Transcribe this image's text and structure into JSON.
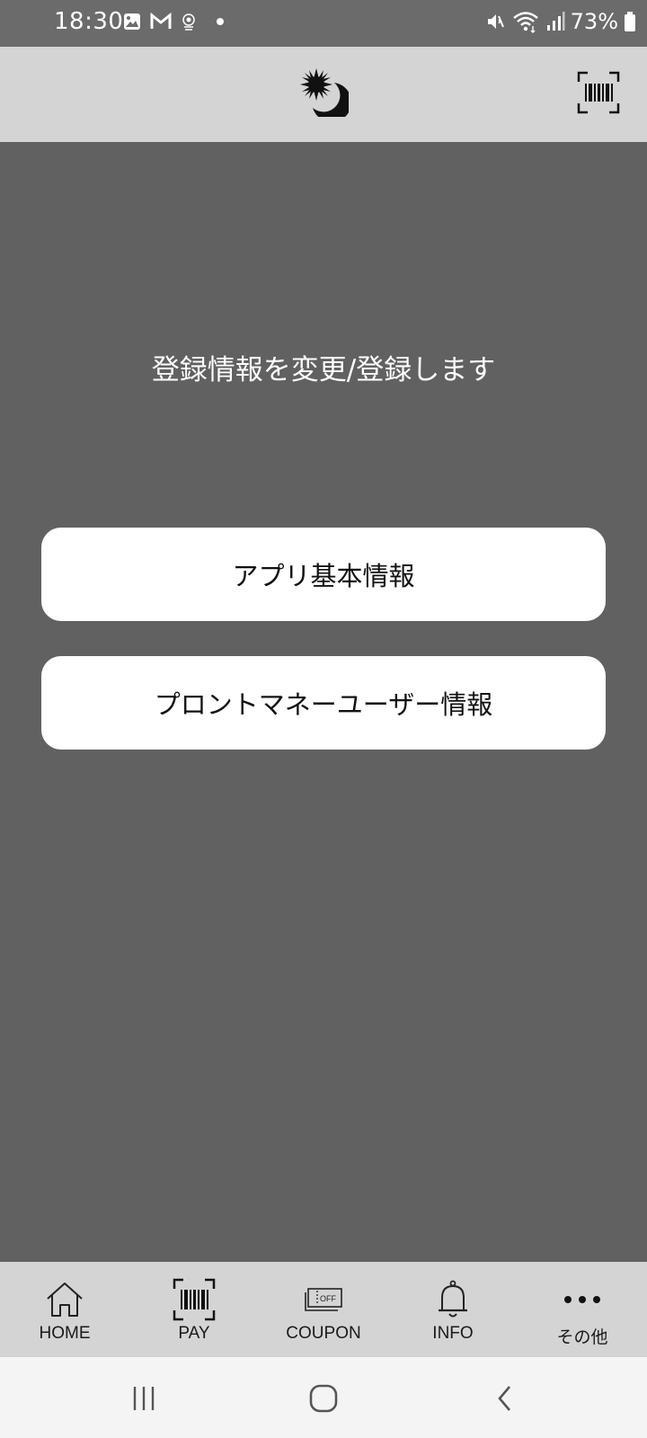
{
  "status_bar": {
    "time": "18:30",
    "battery": "73%",
    "left_icons": [
      "gallery-icon",
      "gmail-icon",
      "app-notification-icon",
      "dot-icon"
    ],
    "right_icons": [
      "mute-icon",
      "wifi-icon",
      "signal-icon",
      "battery-icon"
    ]
  },
  "header": {
    "logo": "sun-moon-logo",
    "barcode_button": "barcode-scan-icon"
  },
  "main": {
    "heading": "登録情報を変更/登録します",
    "buttons": [
      {
        "label": "アプリ基本情報"
      },
      {
        "label": "プロントマネーユーザー情報"
      }
    ]
  },
  "tabbar": {
    "tabs": [
      {
        "label": "HOME",
        "icon": "home-icon"
      },
      {
        "label": "PAY",
        "icon": "barcode-icon"
      },
      {
        "label": "COUPON",
        "icon": "coupon-icon",
        "icon_text": "OFF"
      },
      {
        "label": "INFO",
        "icon": "bell-icon"
      },
      {
        "label": "その他",
        "icon": "more-icon"
      }
    ]
  },
  "colors": {
    "background": "#616161",
    "header": "#d4d4d4",
    "button": "#ffffff",
    "status_bar": "#6b6b6b"
  }
}
